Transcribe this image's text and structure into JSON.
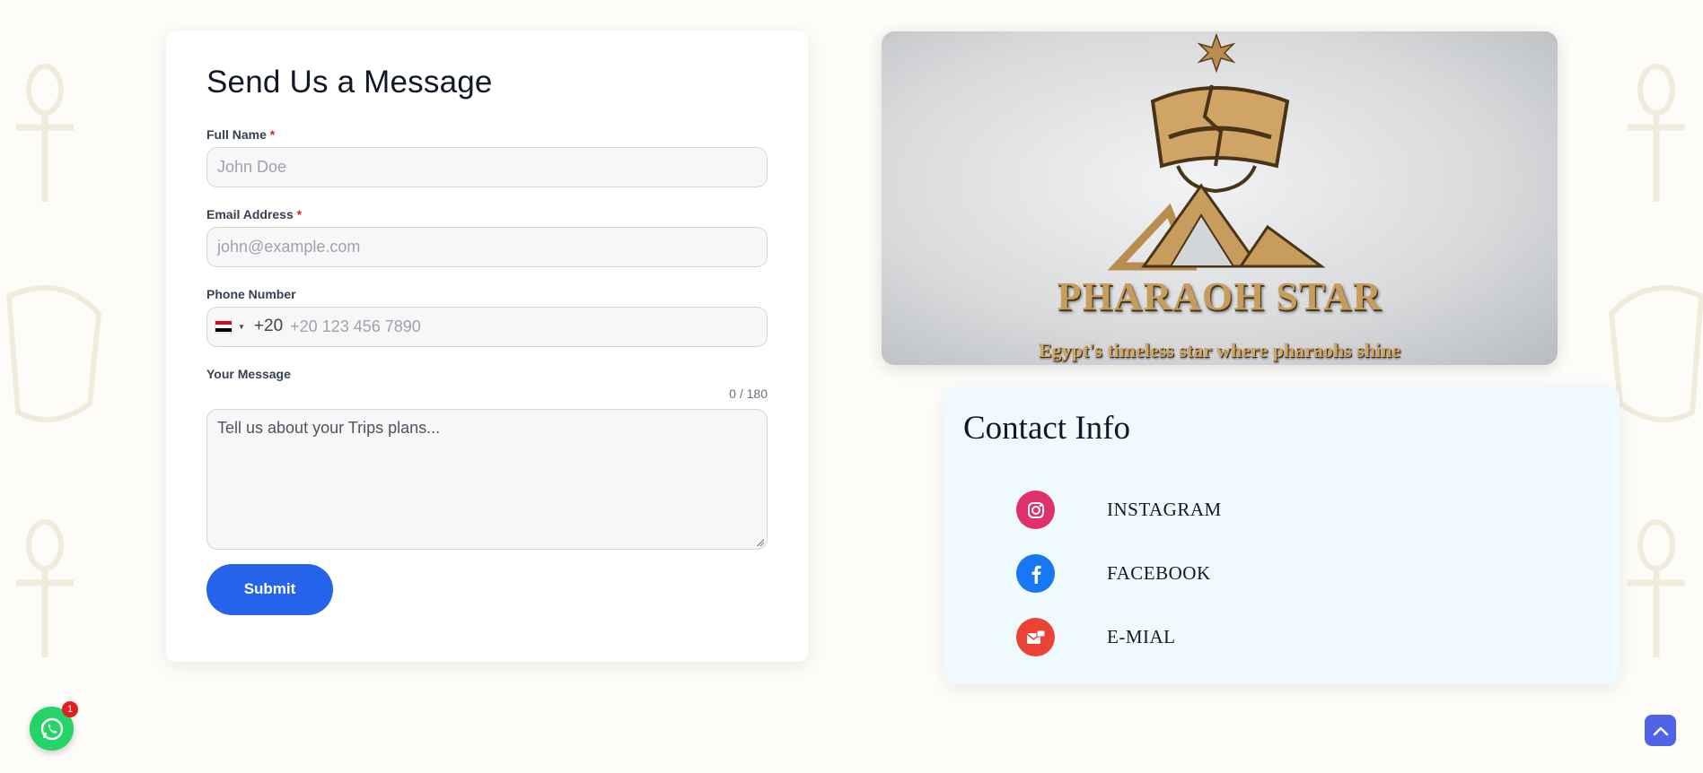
{
  "form": {
    "title": "Send Us a Message",
    "full_name": {
      "label": "Full Name",
      "required_mark": "*",
      "placeholder": "John Doe"
    },
    "email": {
      "label": "Email Address",
      "required_mark": "*",
      "placeholder": "john@example.com"
    },
    "phone": {
      "label": "Phone Number",
      "dial_code": "+20",
      "placeholder": "+20 123 456 7890",
      "country_flag_icon": "egypt-flag-icon"
    },
    "message": {
      "label": "Your Message",
      "counter": "0 / 180",
      "placeholder": "Tell us about your Trips plans..."
    },
    "submit_label": "Submit",
    "colors": {
      "submit": "#2563eb",
      "required": "#dc2626"
    }
  },
  "brand": {
    "name": "PHARAOH STAR",
    "tagline": "Egypt's timeless star where pharaohs shine"
  },
  "contact": {
    "title": "Contact Info",
    "items": [
      {
        "label": "INSTAGRAM",
        "icon": "instagram-icon",
        "color": "#e1306c"
      },
      {
        "label": "FACEBOOK",
        "icon": "facebook-icon",
        "color": "#1877f2"
      },
      {
        "label": "E-MIAL",
        "icon": "email-icon",
        "color": "#ea4335"
      }
    ]
  },
  "floating": {
    "whatsapp_icon": "whatsapp-icon",
    "whatsapp_badge": "1",
    "back_to_top_icon": "chevron-up-icon"
  }
}
